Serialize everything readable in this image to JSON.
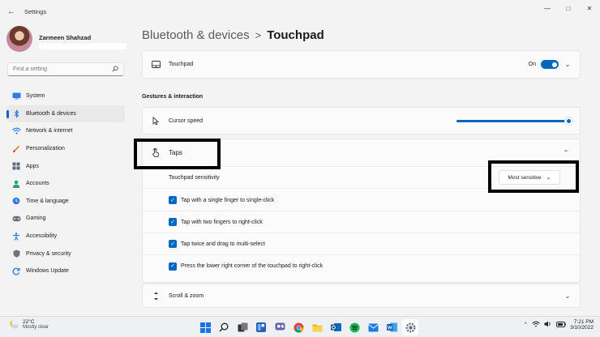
{
  "window": {
    "title": "Settings",
    "back_icon": "arrow-left-icon",
    "controls": [
      "minimize-icon",
      "maximize-icon",
      "close-icon"
    ]
  },
  "profile": {
    "name": "Zarmeen Shahzad"
  },
  "search": {
    "placeholder": "Find a setting"
  },
  "sidebar": {
    "items": [
      {
        "label": "System",
        "icon": "monitor-icon",
        "active": false
      },
      {
        "label": "Bluetooth & devices",
        "icon": "bluetooth-icon",
        "active": true
      },
      {
        "label": "Network & internet",
        "icon": "wifi-icon",
        "active": false
      },
      {
        "label": "Personalization",
        "icon": "brush-icon",
        "active": false
      },
      {
        "label": "Apps",
        "icon": "apps-icon",
        "active": false
      },
      {
        "label": "Accounts",
        "icon": "person-icon",
        "active": false
      },
      {
        "label": "Time & language",
        "icon": "globe-clock-icon",
        "active": false
      },
      {
        "label": "Gaming",
        "icon": "gamepad-icon",
        "active": false
      },
      {
        "label": "Accessibility",
        "icon": "accessibility-icon",
        "active": false
      },
      {
        "label": "Privacy & security",
        "icon": "shield-icon",
        "active": false
      },
      {
        "label": "Windows Update",
        "icon": "refresh-icon",
        "active": false
      }
    ]
  },
  "breadcrumb": {
    "parent": "Bluetooth & devices",
    "separator": ">",
    "current": "Touchpad"
  },
  "touchpad_card": {
    "label": "Touchpad",
    "state": "On",
    "toggle_on": true
  },
  "section": {
    "title": "Gestures & interaction"
  },
  "cursor_speed": {
    "label": "Cursor speed",
    "level": 1.0
  },
  "taps": {
    "label": "Taps",
    "expanded": true,
    "sensitivity_label": "Touchpad sensitivity",
    "sensitivity_value": "Most sensitive",
    "options": [
      {
        "label": "Tap with a single finger to single-click",
        "checked": true
      },
      {
        "label": "Tap with two fingers to right-click",
        "checked": true
      },
      {
        "label": "Tap twice and drag to multi-select",
        "checked": true
      },
      {
        "label": "Press the lower right corner of the touchpad to right-click",
        "checked": true
      }
    ]
  },
  "scroll_zoom": {
    "label": "Scroll & zoom"
  },
  "taskbar": {
    "weather_temp": "22°C",
    "weather_cond": "Mostly clear",
    "time": "7:21 PM",
    "date": "3/10/2022",
    "apps": [
      "windows-start-icon",
      "search-icon",
      "task-view-icon",
      "widgets-icon",
      "chat-icon",
      "chrome-icon",
      "file-explorer-icon",
      "outlook-icon",
      "spotify-icon",
      "mail-icon",
      "word-icon",
      "settings-icon"
    ]
  },
  "colors": {
    "accent": "#0067c0",
    "background": "#f3f3f3",
    "card": "#fbfbfb"
  }
}
